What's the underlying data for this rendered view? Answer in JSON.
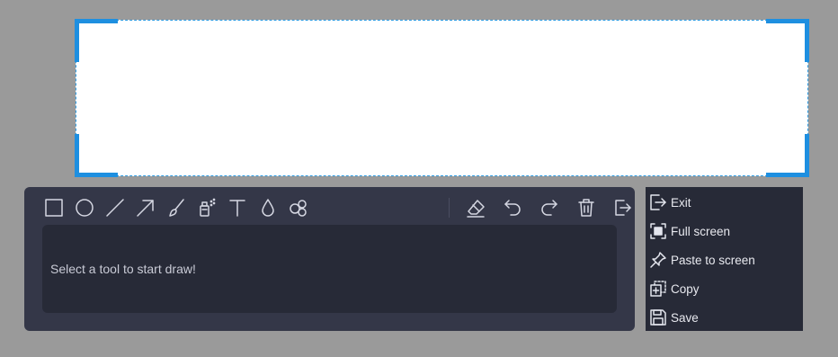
{
  "hint": {
    "text": "Select a tool to start draw!"
  },
  "toolbar": {
    "tools": [
      "rectangle",
      "ellipse",
      "line",
      "arrow",
      "brush",
      "spray",
      "text",
      "blur-drop",
      "number-marker"
    ],
    "actions": [
      "eraser",
      "undo",
      "redo",
      "delete",
      "exit"
    ]
  },
  "menu": {
    "items": [
      {
        "label": "Exit"
      },
      {
        "label": "Full screen"
      },
      {
        "label": "Paste to screen"
      },
      {
        "label": "Copy"
      },
      {
        "label": "Save"
      }
    ]
  },
  "colors": {
    "selection_border": "#1e8fe0",
    "panel_bg": "#343748",
    "hint_bg": "#272a37",
    "menu_bg": "#272a37"
  }
}
